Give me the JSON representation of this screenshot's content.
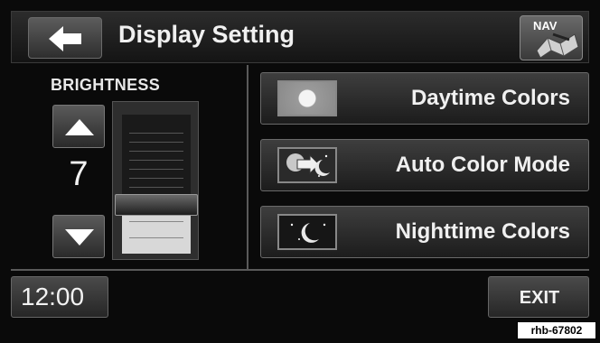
{
  "header": {
    "title": "Display Setting",
    "nav_label": "NAV",
    "back_icon": "arrow-left-icon"
  },
  "brightness": {
    "label": "BRIGHTNESS",
    "value": "7",
    "level_fraction": 0.35
  },
  "modes": [
    {
      "label": "Daytime Colors",
      "icon": "sun-icon"
    },
    {
      "label": "Auto Color Mode",
      "icon": "sun-moon-icon"
    },
    {
      "label": "Nighttime Colors",
      "icon": "moon-icon"
    }
  ],
  "footer": {
    "clock": "12:00",
    "exit_label": "EXIT"
  },
  "reference_tag": "rhb-67802",
  "colors": {
    "background": "#0a0a0a",
    "text": "#f0f0f0",
    "button": "#3a3a3a"
  }
}
